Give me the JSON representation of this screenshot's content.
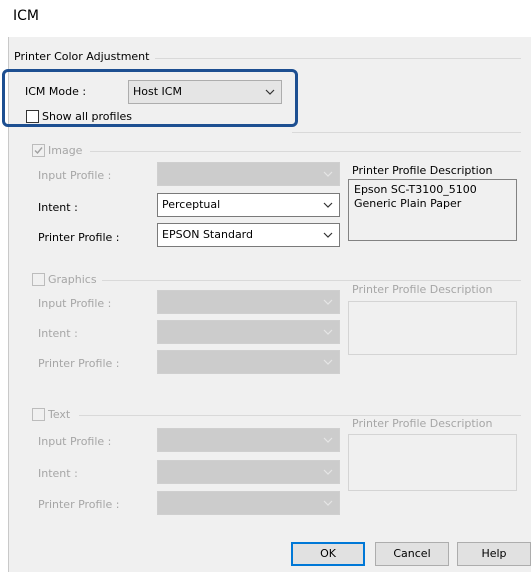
{
  "window": {
    "title": "ICM"
  },
  "group_title": "Printer Color Adjustment",
  "icm_mode": {
    "label": "ICM Mode :",
    "value": "Host ICM"
  },
  "show_all_profiles": {
    "label": "Show all profiles",
    "checked": false
  },
  "image": {
    "label": "Image",
    "checked": true,
    "input_profile_label": "Input Profile :",
    "intent_label": "Intent :",
    "intent_value": "Perceptual",
    "printer_profile_label": "Printer Profile :",
    "printer_profile_value": "EPSON Standard",
    "description_label": "Printer Profile Description",
    "description_text": "Epson SC-T3100_5100 Generic Plain Paper"
  },
  "graphics": {
    "label": "Graphics",
    "checked": false,
    "input_profile_label": "Input Profile :",
    "intent_label": "Intent :",
    "printer_profile_label": "Printer Profile :",
    "description_label": "Printer Profile Description"
  },
  "text": {
    "label": "Text",
    "checked": false,
    "input_profile_label": "Input Profile :",
    "intent_label": "Intent :",
    "printer_profile_label": "Printer Profile :",
    "description_label": "Printer Profile Description"
  },
  "buttons": {
    "ok": "OK",
    "cancel": "Cancel",
    "help": "Help"
  },
  "colors": {
    "highlight": "#1d4f91",
    "default_button": "#0078d7",
    "panel": "#f0f0f0"
  }
}
